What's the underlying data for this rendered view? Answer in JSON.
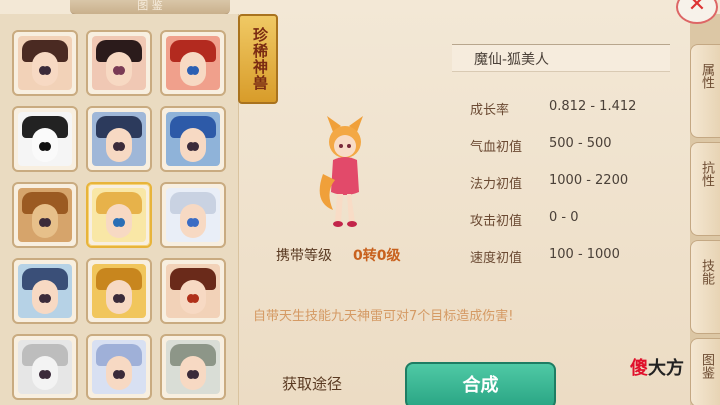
{
  "header": {
    "title": "图 鉴"
  },
  "seal": {
    "label": "珍稀神兽"
  },
  "pet": {
    "name": "魔仙-狐美人",
    "carry_label": "携带等级",
    "carry_value": "0转0级",
    "innate_skill": "自带天生技能九天神雷可对7个目标造成伤害!"
  },
  "stats": [
    {
      "label": "成长率",
      "value": "0.812 - 1.412"
    },
    {
      "label": "气血初值",
      "value": "500 - 500"
    },
    {
      "label": "法力初值",
      "value": "1000 - 2200"
    },
    {
      "label": "攻击初值",
      "value": "0 - 0"
    },
    {
      "label": "速度初值",
      "value": "100 - 1000"
    }
  ],
  "actions": {
    "source": "获取途径",
    "compose": "合成"
  },
  "tabs": [
    {
      "label": "属性"
    },
    {
      "label": "抗性"
    },
    {
      "label": "技能"
    },
    {
      "label": "图鉴"
    }
  ],
  "close_symbol": "✕",
  "watermark": {
    "a": "傻",
    "b": "大方"
  },
  "colors": {
    "accent": "#2aa584",
    "seal": "#e0b04a",
    "highlight": "#c8611e"
  }
}
